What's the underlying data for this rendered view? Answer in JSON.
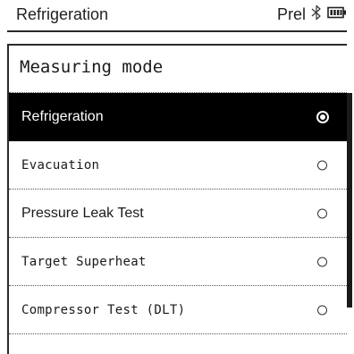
{
  "status_bar": {
    "title": "Refrigeration",
    "mode_tag": "Prel",
    "bluetooth_icon": "bluetooth-icon",
    "battery_icon": "battery-icon"
  },
  "panel": {
    "heading": "Measuring mode"
  },
  "modes": [
    {
      "label": "Refrigeration",
      "selected": true
    },
    {
      "label": "Evacuation",
      "selected": false
    },
    {
      "label": "Pressure Leak Test",
      "selected": false
    },
    {
      "label": "Target Superheat",
      "selected": false
    },
    {
      "label": "Compressor Test (DLT)",
      "selected": false
    }
  ],
  "colors": {
    "selected_background": "#000000",
    "selected_text": "#ffffff",
    "text": "#1a1a1a"
  }
}
